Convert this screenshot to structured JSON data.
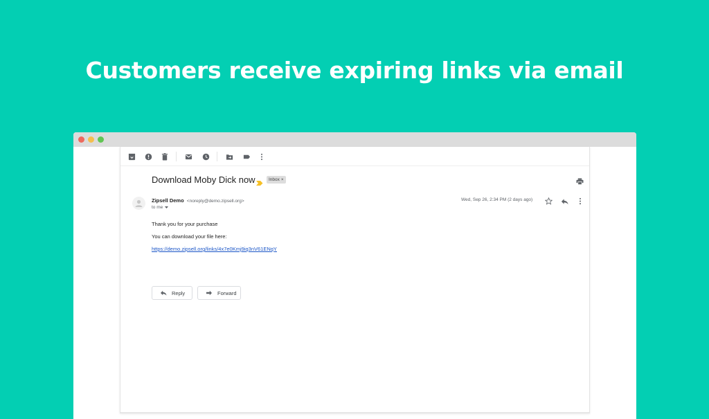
{
  "headline": "Customers receive expiring links via email",
  "window": {
    "traffic_lights": [
      "close",
      "minimize",
      "maximize"
    ]
  },
  "toolbar": {
    "icons": [
      "archive-icon",
      "report-spam-icon",
      "delete-icon",
      "mark-unread-icon",
      "snooze-icon",
      "move-to-icon",
      "label-icon",
      "more-icon"
    ]
  },
  "email": {
    "subject": "Download Moby Dick now",
    "label": "Inbox",
    "label_close": "×",
    "sender_name": "Zipsell Demo",
    "sender_email": "<noreply@demo.zipsell.org>",
    "recipient": "to me",
    "date": "Wed, Sep 26, 2:34 PM (2 days ago)",
    "body": {
      "line1": "Thank you for your purchase",
      "line2": "You can download your file here:",
      "link": "https://demo.zipsell.org/links/4x7e0Kmj9iq3nV61ENqY"
    },
    "actions": {
      "reply": "Reply",
      "forward": "Forward"
    }
  },
  "colors": {
    "background": "#03cfb3",
    "link": "#1a55c7",
    "importance_marker": "#f6c026"
  }
}
